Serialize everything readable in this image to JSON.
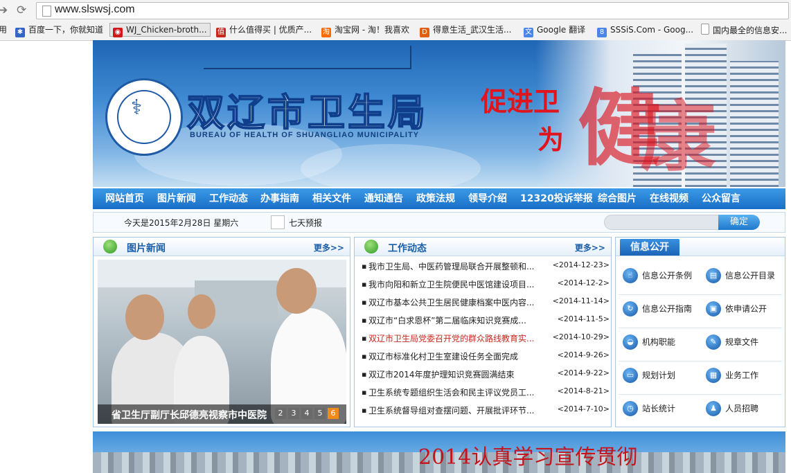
{
  "browser": {
    "url": "www.slswsj.com",
    "bookmarks": [
      {
        "label": "用",
        "color": "#888888"
      },
      {
        "label": "百度一下，你就知道",
        "color": "#3264c8"
      },
      {
        "label": "WJ_Chicken-broth...",
        "color": "#d01818"
      },
      {
        "label": "什么值得买 | 优质产...",
        "color": "#c8281e"
      },
      {
        "label": "淘宝网 - 淘！我喜欢",
        "color": "#ff6a00"
      },
      {
        "label": "得意生活_武汉生活...",
        "color": "#e06010"
      },
      {
        "label": "Google 翻译",
        "color": "#4a86e8"
      },
      {
        "label": "SSSiS.Com - Goog...",
        "color": "#4a86e8"
      },
      {
        "label": "国内最全的信息安...",
        "color": "#999999"
      }
    ]
  },
  "banner": {
    "title": "双辽市卫生局",
    "subtitle": "BUREAU OF HEALTH OF SHUANGLIAO MUNICIPALITY",
    "slogan_line1": "促进卫",
    "slogan_line2": "为"
  },
  "nav": {
    "items": [
      "网站首页",
      "图片新闻",
      "工作动态",
      "办事指南",
      "相关文件",
      "通知通告",
      "政策法规",
      "领导介绍",
      "12320投诉举报",
      "综合图片",
      "在线视频",
      "公众留言"
    ]
  },
  "infobar": {
    "date": "今天是2015年2月28日  星期六",
    "forecast": "七天预报",
    "search_button": "确定"
  },
  "photo_news": {
    "title": "图片新闻",
    "more": "更多>>",
    "caption": "省卫生厅副厅长邱德亮视察市中医院",
    "pages": [
      "2",
      "3",
      "4",
      "5",
      "6"
    ],
    "active_page": "6"
  },
  "work_news": {
    "title": "工作动态",
    "more": "更多>>",
    "items": [
      {
        "title": "我市卫生局、中医药管理局联合开展整顿和...",
        "date": "<2014-12-23>"
      },
      {
        "title": "我市向阳和新立卫生院便民中医馆建设项目...",
        "date": "<2014-12-2>"
      },
      {
        "title": "双辽市基本公共卫生居民健康档案中医内容...",
        "date": "<2014-11-14>"
      },
      {
        "title": "双辽市“白求恩杯”第二届临床知识竞赛成...",
        "date": "<2014-11-5>"
      },
      {
        "title": "双辽市卫生局党委召开党的群众路线教育实...",
        "date": "<2014-10-29>"
      },
      {
        "title": "双辽市标准化村卫生室建设任务全面完成",
        "date": "<2014-9-26>"
      },
      {
        "title": "双辽市2014年度护理知识竞赛圆满结束",
        "date": "<2014-9-22>"
      },
      {
        "title": "卫生系统专题组织生活会和民主评议党员工...",
        "date": "<2014-8-21>"
      },
      {
        "title": "卫生系统督导组对查摆问题、开展批评环节...",
        "date": "<2014-7-10>"
      }
    ]
  },
  "info_open": {
    "title": "信息公开",
    "items": [
      "信息公开条例",
      "信息公开目录",
      "信息公开指南",
      "依申请公开",
      "机构职能",
      "规章文件",
      "规划计划",
      "业务工作",
      "站长统计",
      "人员招聘"
    ]
  },
  "bottom_banner": {
    "text": "2014认真学习宣传贯彻"
  }
}
